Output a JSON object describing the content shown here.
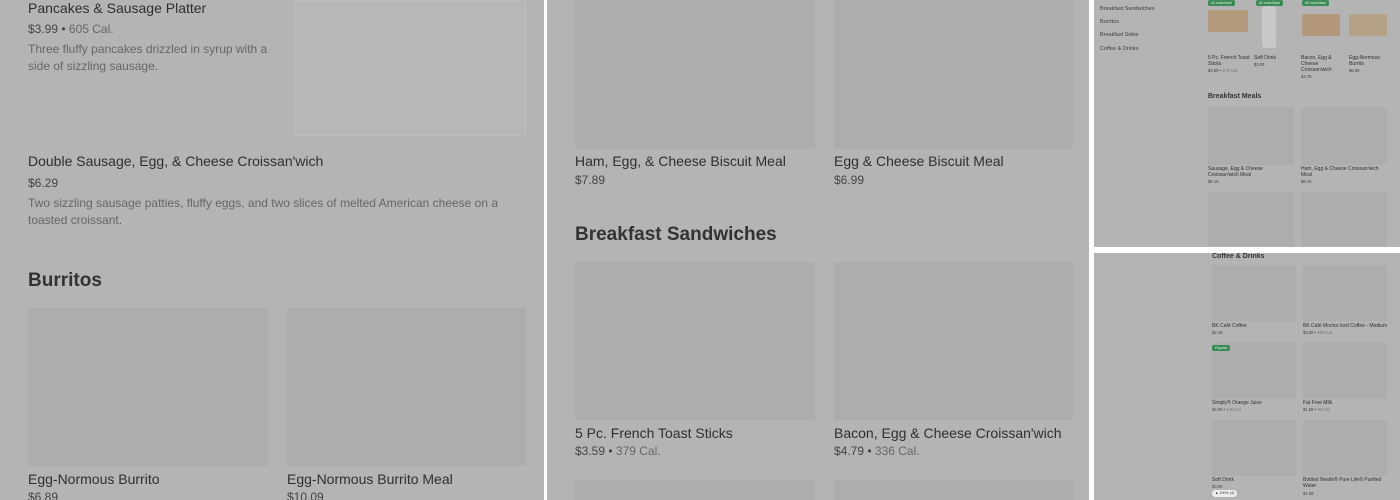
{
  "panel1": {
    "item_pancakes": {
      "title": "Pancakes & Sausage Platter",
      "price": "$3.99",
      "separator": " • ",
      "calories": "605 Cal.",
      "description": "Three fluffy pancakes drizzled in syrup with a side of sizzling sausage."
    },
    "item_croissanwich": {
      "title": "Double Sausage, Egg, & Cheese Croissan'wich",
      "price": "$6.29",
      "description": "Two sizzling sausage patties, fluffy eggs, and two slices of melted American cheese on a toasted croissant."
    },
    "section_burritos": "Burritos",
    "burrito_items": [
      {
        "title": "Egg-Normous Burrito",
        "price": "$6.89"
      },
      {
        "title": "Egg-Normous Burrito Meal",
        "price": "$10.09"
      }
    ]
  },
  "panel2": {
    "meal_items": [
      {
        "title": "Ham, Egg, & Cheese Biscuit Meal",
        "price": "$7.89"
      },
      {
        "title": "Egg & Cheese Biscuit Meal",
        "price": "$6.99"
      }
    ],
    "section_sandwiches": "Breakfast Sandwiches",
    "sandwich_items": [
      {
        "title": "5 Pc. French Toast Sticks",
        "price": "$3.59",
        "calories": "379 Cal."
      },
      {
        "title": "Bacon, Egg & Cheese Croissan'wich",
        "price": "$4.79",
        "calories": "336 Cal."
      }
    ]
  },
  "panel3": {
    "sidebar": [
      "Breakfast Sandwiches",
      "Burritos",
      "Breakfast Sides",
      "Coffee & Drinks"
    ],
    "featured": [
      {
        "badge": "#2 most liked",
        "title": "5 Pc. French Toast Sticks",
        "price": "$3.59",
        "calories": "379 Cal."
      },
      {
        "badge": "#1 most liked",
        "title": "Soft Drink",
        "price": "$3.09",
        "calories": ""
      },
      {
        "badge": "#3 most liked",
        "title": "Bacon, Egg & Cheese Croissan'wich",
        "price": "$4.79",
        "calories": ""
      },
      {
        "badge": "",
        "title": "Egg-Normous Burrito",
        "price": "$6.89",
        "calories": ""
      }
    ],
    "section_meals": "Breakfast Meals",
    "meals": [
      {
        "title": "Sausage, Egg & Cheese Croissan'wich Meal",
        "price": "$6.19"
      },
      {
        "title": "Ham, Egg & Cheese Croissan'wich Meal",
        "price": "$6.19"
      }
    ]
  },
  "panel4": {
    "section_drinks": "Coffee & Drinks",
    "drinks": [
      {
        "badge": "",
        "title": "BK Café Coffee",
        "price": "$2.19",
        "calories": ""
      },
      {
        "badge": "",
        "title": "BK Café Mocha Iced Coffee - Medium",
        "price": "$3.59",
        "calories": "250 Cal."
      },
      {
        "badge": "Popular",
        "title": "Simply® Orange Juice",
        "price": "$2.59",
        "calories": "140 Cal."
      },
      {
        "badge": "",
        "title": "Fat Free Milk",
        "price": "$1.59",
        "calories": "90 Cal."
      },
      {
        "badge": "",
        "title": "Soft Drink",
        "price": "$3.09",
        "calories": "",
        "pill": "100% (4)"
      },
      {
        "badge": "",
        "title": "Bottled Nestlé® Pure Life® Purified Water",
        "price": "$1.89",
        "calories": ""
      }
    ]
  },
  "colors": {
    "overlay": "#b4b4b4",
    "placeholder": "#adadad",
    "badge_green": "#3c8a57"
  }
}
